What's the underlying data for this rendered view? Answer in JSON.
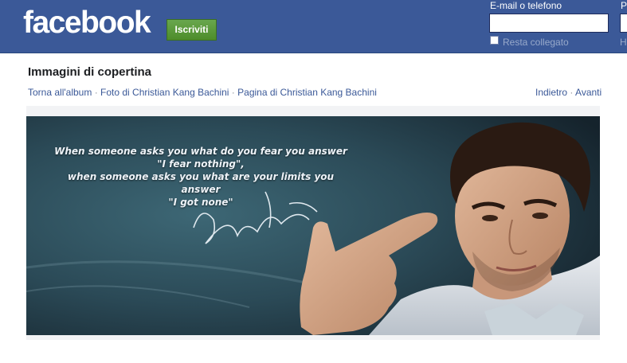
{
  "header": {
    "logo_text": "facebook",
    "signup_label": "Iscriviti",
    "email_label": "E-mail o telefono",
    "password_label": "P",
    "keep_logged_label": "Resta collegato",
    "forgot_label": "H",
    "email_value": "",
    "password_value": ""
  },
  "page": {
    "title": "Immagini di copertina",
    "breadcrumbs": [
      "Torna all'album",
      "Foto di Christian Kang Bachini",
      "Pagina di Christian Kang Bachini"
    ],
    "nav": {
      "prev_label": "Indietro",
      "next_label": "Avanti"
    }
  },
  "photo": {
    "quote_lines": [
      "When someone asks you what do you fear you answer",
      "\"I fear nothing\",",
      "when someone asks you what are your limits you answer",
      "\"I got none\""
    ],
    "signature_text": "Christian"
  },
  "colors": {
    "brand_blue": "#3b5998",
    "signup_green": "#5b9a1a",
    "link_blue": "#3b5998"
  }
}
